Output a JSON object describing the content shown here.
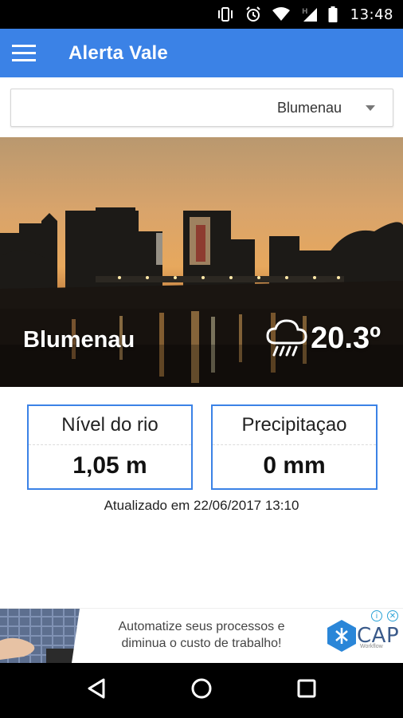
{
  "status_bar": {
    "time": "13:48",
    "icons": [
      "vibrate-icon",
      "alarm-icon",
      "wifi-icon",
      "network-h-icon",
      "signal-icon",
      "battery-icon"
    ]
  },
  "app_bar": {
    "title": "Alerta Vale",
    "menu_icon": "hamburger-menu-icon",
    "color": "#3b82e6"
  },
  "city_selector": {
    "selected": "Blumenau"
  },
  "hero": {
    "city": "Blumenau",
    "temperature": "20.3º",
    "weather_icon": "rain-cloud-icon"
  },
  "cards": [
    {
      "title": "Nível do rio",
      "value": "1,05 m"
    },
    {
      "title": "Precipitaçao",
      "value": "0 mm"
    }
  ],
  "updated_text": "Atualizado em 22/06/2017 13:10",
  "ad": {
    "line1": "Automatize seus processos e",
    "line2": "diminua o custo de trabalho!",
    "logo": "CAP",
    "logo_sub": "Workflow"
  },
  "nav_bar": {
    "icons": [
      "back-icon",
      "home-icon",
      "recents-icon"
    ]
  }
}
